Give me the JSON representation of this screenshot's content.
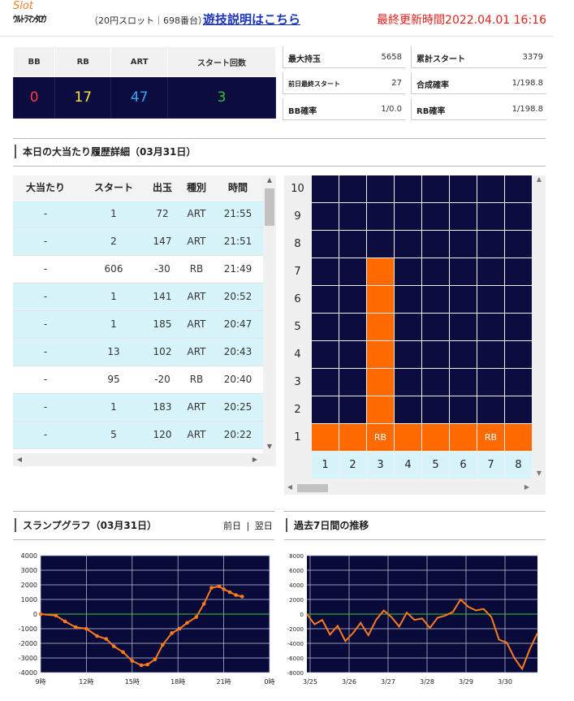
{
  "header": {
    "slot_label": "Slot",
    "machine_name": "ｳﾙﾄﾗﾏﾝﾀﾛｳ",
    "machine_info": "（20円スロット｜698番台）",
    "explain_link": "遊技説明はこちら",
    "last_updated": "最終更新時間2022.04.01 16:16"
  },
  "summary": {
    "headers": [
      "BB",
      "RB",
      "ART",
      "スタート回数"
    ],
    "values": [
      "0",
      "17",
      "47",
      "3"
    ],
    "colors": [
      "#ff3b3b",
      "#f6e33a",
      "#2ea7ff",
      "#27c431"
    ]
  },
  "stats": [
    {
      "label": "最大持玉",
      "value": "5658"
    },
    {
      "label": "累計スタート",
      "value": "3379"
    },
    {
      "label": "前日最終スタート",
      "value": "27"
    },
    {
      "label": "合成確率",
      "value": "1/198.8"
    },
    {
      "label": "BB確率",
      "value": "1/0.0"
    },
    {
      "label": "RB確率",
      "value": "1/198.8"
    }
  ],
  "history": {
    "title": "本日の大当たり履歴詳細（03月31日）",
    "headers": [
      "大当たり",
      "スタート",
      "出玉",
      "種別",
      "時間"
    ],
    "rows": [
      [
        "-",
        "1",
        "72",
        "ART",
        "21:55"
      ],
      [
        "-",
        "2",
        "147",
        "ART",
        "21:51"
      ],
      [
        "-",
        "606",
        "-30",
        "RB",
        "21:49"
      ],
      [
        "-",
        "1",
        "141",
        "ART",
        "20:52"
      ],
      [
        "-",
        "1",
        "185",
        "ART",
        "20:47"
      ],
      [
        "-",
        "13",
        "102",
        "ART",
        "20:43"
      ],
      [
        "-",
        "95",
        "-20",
        "RB",
        "20:40"
      ],
      [
        "-",
        "1",
        "183",
        "ART",
        "20:25"
      ],
      [
        "-",
        "5",
        "120",
        "ART",
        "20:22"
      ]
    ]
  },
  "bar_grid": {
    "y_labels": [
      "10",
      "9",
      "8",
      "7",
      "6",
      "5",
      "4",
      "3",
      "2",
      "1"
    ],
    "x_labels": [
      "1",
      "2",
      "3",
      "4",
      "5",
      "6",
      "7",
      "8"
    ],
    "columns": [
      {
        "level": 1,
        "label": ""
      },
      {
        "level": 1,
        "label": ""
      },
      {
        "level": 7,
        "label": "RB"
      },
      {
        "level": 1,
        "label": ""
      },
      {
        "level": 1,
        "label": ""
      },
      {
        "level": 1,
        "label": ""
      },
      {
        "level": 1,
        "label": "RB"
      },
      {
        "level": 1,
        "label": ""
      },
      {
        "level": 1,
        "label": ""
      }
    ]
  },
  "slump": {
    "title": "スランプグラフ（03月31日）",
    "prev": "前日",
    "sep": "|",
    "next": "翌日"
  },
  "weekly": {
    "title": "過去7日間の推移"
  },
  "chart_data": [
    {
      "type": "line",
      "title": "スランプグラフ（03月31日）",
      "x_tick_labels": [
        "9時",
        "12時",
        "15時",
        "18時",
        "21時",
        "0時"
      ],
      "x_range_hours": [
        9,
        24
      ],
      "ylim": [
        -4000,
        4000
      ],
      "y_ticks": [
        4000,
        3000,
        2000,
        1000,
        0,
        -1000,
        -2000,
        -3000,
        -4000
      ],
      "grid": true,
      "series": [
        {
          "x": [
            9.0,
            10.0,
            10.6,
            11.3,
            12.0,
            12.7,
            13.3,
            13.8,
            14.4,
            15.0,
            15.6,
            16.0,
            16.5,
            17.0,
            17.6,
            18.1,
            18.6,
            19.2,
            19.7,
            20.2,
            20.7,
            21.0,
            21.4,
            21.8,
            22.2
          ],
          "y": [
            0,
            -100,
            -500,
            -900,
            -1000,
            -1500,
            -1700,
            -2200,
            -2600,
            -3200,
            -3500,
            -3450,
            -3100,
            -2100,
            -1300,
            -1000,
            -600,
            -200,
            700,
            1800,
            1900,
            1700,
            1500,
            1300,
            1200
          ]
        }
      ]
    },
    {
      "type": "line",
      "title": "過去7日間の推移",
      "x_tick_labels": [
        "3/25",
        "3/26",
        "3/27",
        "3/28",
        "3/29",
        "3/30"
      ],
      "ylim": [
        -8000,
        8000
      ],
      "y_ticks": [
        8000,
        6000,
        4000,
        2000,
        0,
        -2000,
        -4000,
        -6000,
        -8000
      ],
      "grid": true,
      "series": [
        {
          "x": [
            "3/25",
            "3/25",
            "3/25",
            "3/25",
            "3/25",
            "3/26",
            "3/26",
            "3/26",
            "3/26",
            "3/26",
            "3/27",
            "3/27",
            "3/27",
            "3/27",
            "3/27",
            "3/28",
            "3/28",
            "3/28",
            "3/28",
            "3/28",
            "3/29",
            "3/29",
            "3/29",
            "3/29",
            "3/29",
            "3/30",
            "3/30",
            "3/30",
            "3/30",
            "3/30",
            "3/30"
          ],
          "y": [
            0,
            -1400,
            -800,
            -2800,
            -1600,
            -3700,
            -2600,
            -1200,
            -2900,
            -800,
            500,
            -400,
            -1700,
            200,
            -800,
            -600,
            -1900,
            -500,
            -200,
            300,
            2000,
            1000,
            500,
            700,
            -400,
            -3500,
            -3900,
            -6000,
            -7500,
            -4800,
            -2600
          ]
        }
      ]
    }
  ]
}
